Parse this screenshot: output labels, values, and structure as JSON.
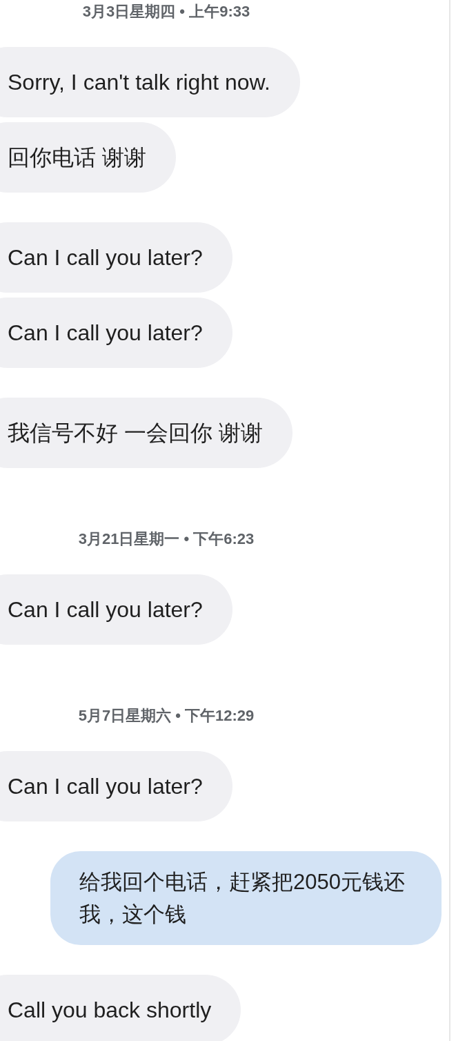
{
  "sections": [
    {
      "timestamp": "3月3日星期四 • 上午9:33",
      "groups": [
        [
          {
            "kind": "received",
            "text": "Sorry, I can't talk right now."
          },
          {
            "kind": "received",
            "text": "回你电话 谢谢"
          }
        ],
        [
          {
            "kind": "received",
            "text": "Can I call you later?"
          },
          {
            "kind": "received",
            "text": "Can I call you later?"
          }
        ],
        [
          {
            "kind": "received",
            "text": "我信号不好 一会回你 谢谢"
          }
        ]
      ]
    },
    {
      "timestamp": "3月21日星期一 • 下午6:23",
      "groups": [
        [
          {
            "kind": "received",
            "text": "Can I call you later?"
          }
        ]
      ]
    },
    {
      "timestamp": "5月7日星期六 • 下午12:29",
      "groups": [
        [
          {
            "kind": "received",
            "text": "Can I call you later?"
          }
        ],
        [
          {
            "kind": "sent",
            "text": "给我回个电话，赶紧把2050元钱还我，这个钱"
          }
        ],
        [
          {
            "kind": "received",
            "text": "Call you back shortly"
          }
        ]
      ]
    }
  ]
}
